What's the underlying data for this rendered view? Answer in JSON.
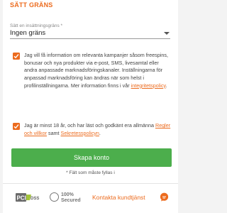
{
  "section_title": "SÄTT GRÄNS",
  "deposit_limit": {
    "label": "Sätt en insättningsgräns *",
    "value": "Ingen gräns"
  },
  "marketing_consent": {
    "checked": true,
    "text": "Jag vill få information om relevanta kampanjer såsom freespins, bonusar och nya produkter via e-post, SMS, livesamtal eller andra anpassade marknadsföringskanaler. Inställningarna för anpassad marknadsföring kan ändras när som helst i profilinställningarna. Mer information finns i vår",
    "link": "integritetspolicy",
    "suffix": "."
  },
  "terms_consent": {
    "checked": true,
    "text": "Jag är minst 18 år, och har läst och godkänt era allmänna",
    "terms_link": "Regler och villkor",
    "middle": "samt",
    "privacy_link": "Sekretesspolicyn",
    "suffix": "."
  },
  "submit_label": "Skapa konto",
  "required_note": "* Fält som måste fyllas i",
  "footer": {
    "pci_text": "DSS",
    "secured_line1": "100%",
    "secured_line2": "Secured",
    "support_label": "Kontakta kundtjänst"
  },
  "colors": {
    "accent": "#ec6b1e",
    "submit": "#4cae4c"
  }
}
